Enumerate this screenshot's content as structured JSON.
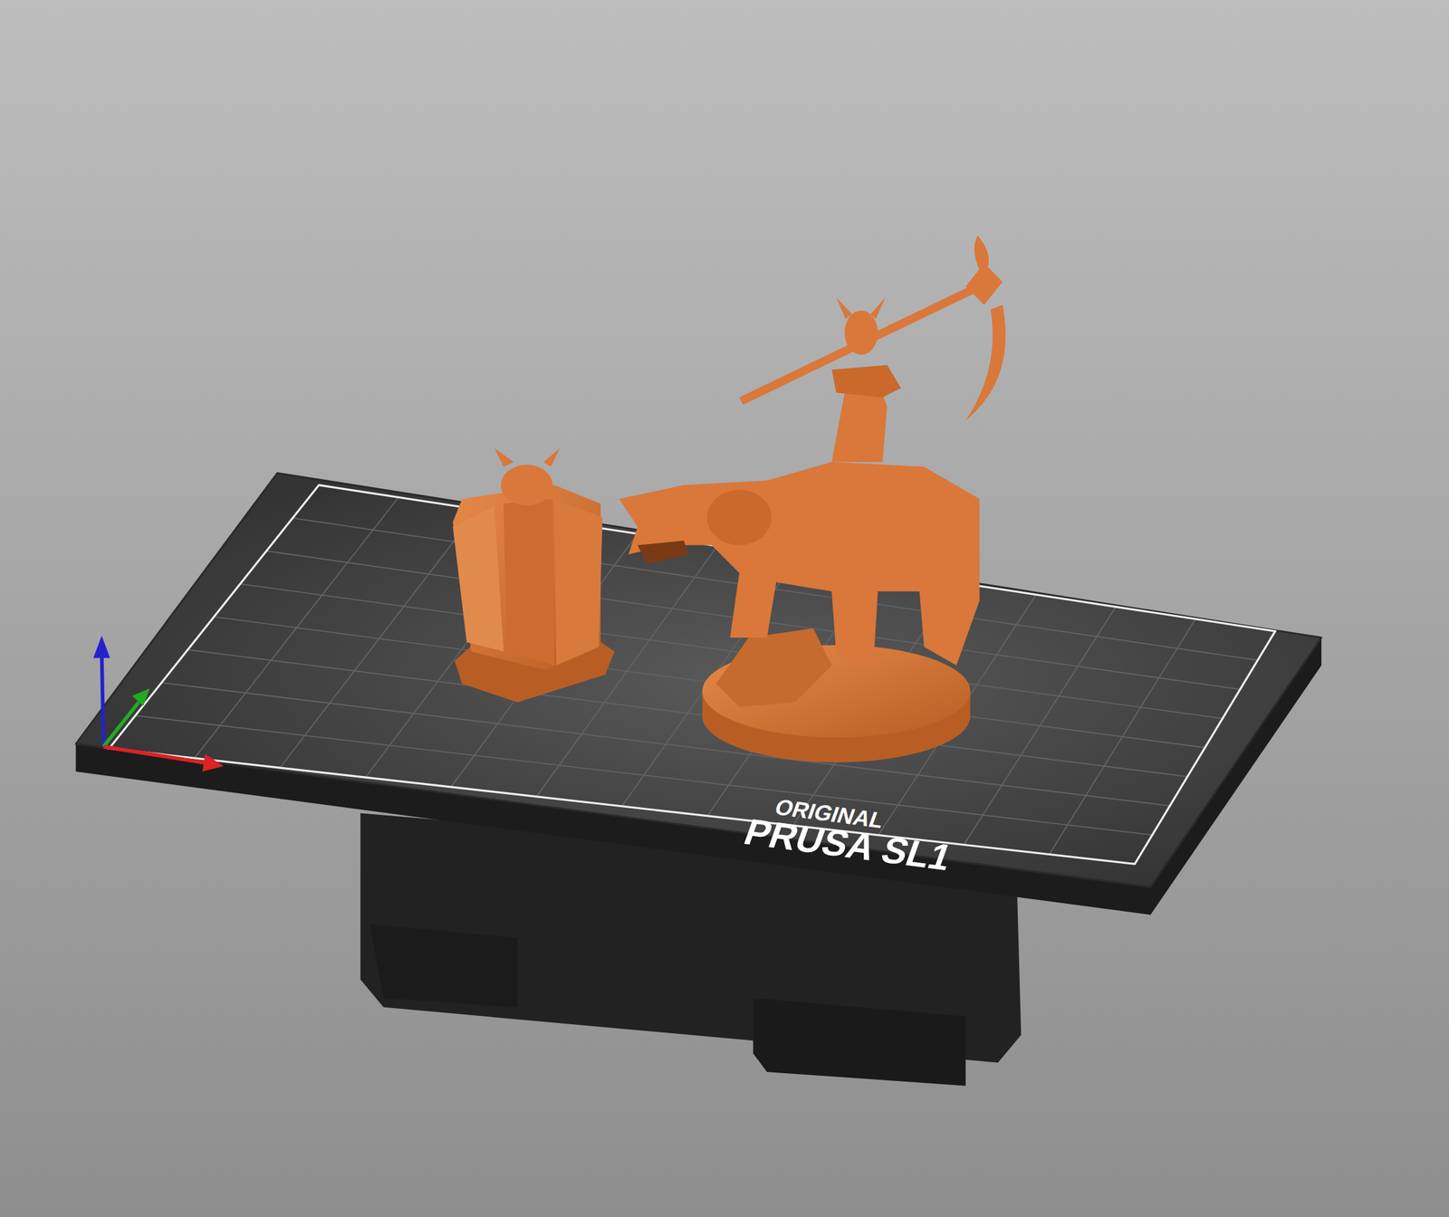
{
  "bed": {
    "logo_line1": "ORIGINAL",
    "logo_line2": "PRUSA SL1"
  }
}
